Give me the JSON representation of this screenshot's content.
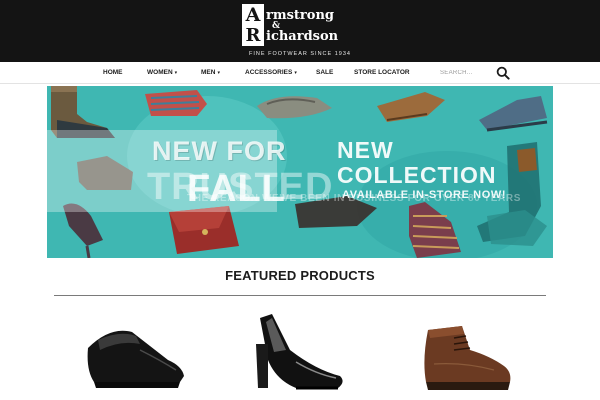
{
  "header": {
    "logo": {
      "cap_a": "A",
      "word_1": "rmstrong",
      "ampersand": "&",
      "cap_r": "R",
      "word_2": "ichardson"
    },
    "tagline": "FINE FOOTWEAR SINCE 1934"
  },
  "nav": {
    "items": [
      {
        "label": "HOME",
        "has_dropdown": false
      },
      {
        "label": "WOMEN",
        "has_dropdown": true
      },
      {
        "label": "MEN",
        "has_dropdown": true
      },
      {
        "label": "ACCESSORIES",
        "has_dropdown": true
      },
      {
        "label": "SALE",
        "has_dropdown": false
      },
      {
        "label": "STORE LOCATOR",
        "has_dropdown": false
      }
    ],
    "dropdown_caret": "▾",
    "search": {
      "placeholder": "SEARCH...",
      "value": "",
      "icon": "search-icon"
    }
  },
  "banner": {
    "background_color": "#3fb7b2",
    "slide_a": {
      "line_1": "NEW FOR",
      "line_2": "FALL"
    },
    "slide_b": {
      "line_1": "NEW",
      "line_2": "COLLECTION",
      "line_3": "AVAILABLE IN-STORE NOW!"
    },
    "overlay_text": {
      "heading": "TRUSTED",
      "subline": "THE REASON WE'VE BEEN IN BUSINESS FOR OVER 80 YEARS"
    }
  },
  "featured": {
    "title": "FEATURED PRODUCTS",
    "products": [
      {
        "icon": "black-loafer-shoe-icon"
      },
      {
        "icon": "black-patent-pump-icon"
      },
      {
        "icon": "brown-chukka-boot-icon"
      }
    ]
  },
  "colors": {
    "header_bg": "#141414",
    "banner_teal": "#3fb7b2",
    "text_dark": "#1c1c1c"
  }
}
